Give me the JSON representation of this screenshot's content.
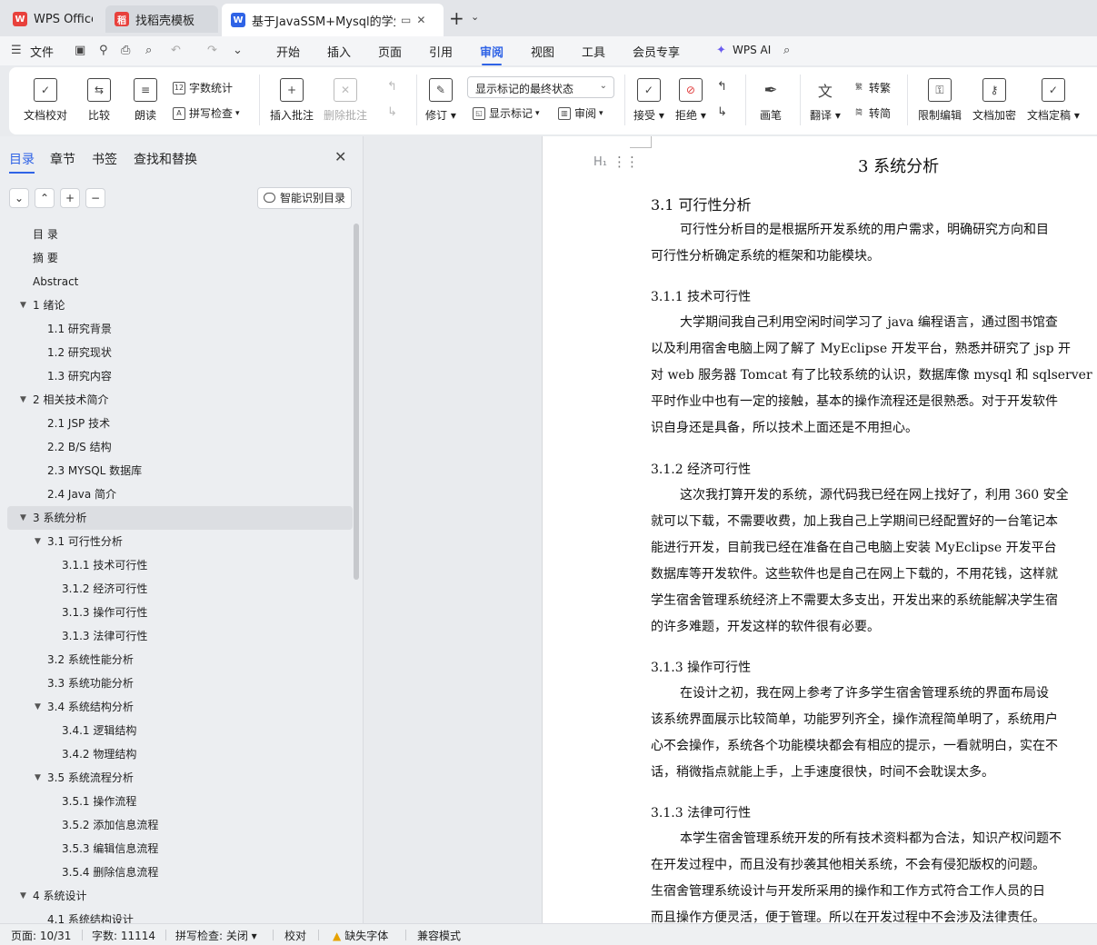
{
  "tabs": [
    {
      "label": "WPS Office",
      "logo": "W",
      "color": "#e8413c"
    },
    {
      "label": "找稻壳模板",
      "logo": "稻",
      "color": "#e8413c"
    },
    {
      "label": "基于JavaSSM+Mysql的学生宿",
      "logo": "W",
      "color": "#2f63e6"
    }
  ],
  "menubar": {
    "file": "文件",
    "items": [
      "开始",
      "插入",
      "页面",
      "引用",
      "审阅",
      "视图",
      "工具",
      "会员专享"
    ],
    "active": "审阅",
    "ai": "WPS AI"
  },
  "ribbon": {
    "doc_check": "文档校对",
    "compare": "比较",
    "read_aloud": "朗读",
    "word_count": "字数统计",
    "spell_check": "拼写检查",
    "insert_comment": "插入批注",
    "delete_comment": "删除批注",
    "revise": "修订",
    "markup_combo": "显示标记的最终状态",
    "show_markup": "显示标记",
    "review": "审阅",
    "accept": "接受",
    "reject": "拒绝",
    "pen": "画笔",
    "translate": "翻译",
    "to_traditional": "转繁",
    "to_simplified": "转简",
    "restrict_edit": "限制编辑",
    "encrypt": "文档加密",
    "finalize": "文档定稿"
  },
  "nav": {
    "tabs": [
      "目录",
      "章节",
      "书签",
      "查找和替换"
    ],
    "smart_btn": "智能识别目录",
    "toc": [
      {
        "text": "目  录",
        "level": 0,
        "caret": false
      },
      {
        "text": "摘    要",
        "level": 0,
        "caret": false
      },
      {
        "text": "Abstract",
        "level": 0,
        "caret": false
      },
      {
        "text": "1  绪论",
        "level": 0,
        "caret": true
      },
      {
        "text": "1.1 研究背景",
        "level": 1,
        "caret": false
      },
      {
        "text": "1.2 研究现状",
        "level": 1,
        "caret": false
      },
      {
        "text": "1.3 研究内容",
        "level": 1,
        "caret": false
      },
      {
        "text": "2  相关技术简介",
        "level": 0,
        "caret": true
      },
      {
        "text": "2.1 JSP 技术",
        "level": 1,
        "caret": false
      },
      {
        "text": "2.2 B/S 结构",
        "level": 1,
        "caret": false
      },
      {
        "text": "2.3 MYSQL 数据库",
        "level": 1,
        "caret": false
      },
      {
        "text": "2.4 Java 简介",
        "level": 1,
        "caret": false
      },
      {
        "text": "3  系统分析",
        "level": 0,
        "caret": true,
        "active": true
      },
      {
        "text": "3.1  可行性分析",
        "level": 1,
        "caret": true
      },
      {
        "text": "3.1.1  技术可行性",
        "level": 2,
        "caret": false
      },
      {
        "text": "3.1.2  经济可行性",
        "level": 2,
        "caret": false
      },
      {
        "text": "3.1.3  操作可行性",
        "level": 2,
        "caret": false
      },
      {
        "text": "3.1.3  法律可行性",
        "level": 2,
        "caret": false
      },
      {
        "text": "3.2  系统性能分析",
        "level": 1,
        "caret": false
      },
      {
        "text": "3.3  系统功能分析",
        "level": 1,
        "caret": false
      },
      {
        "text": "3.4  系统结构分析",
        "level": 1,
        "caret": true
      },
      {
        "text": "3.4.1 逻辑结构",
        "level": 2,
        "caret": false
      },
      {
        "text": "3.4.2  物理结构",
        "level": 2,
        "caret": false
      },
      {
        "text": "3.5  系统流程分析",
        "level": 1,
        "caret": true
      },
      {
        "text": "3.5.1  操作流程",
        "level": 2,
        "caret": false
      },
      {
        "text": "3.5.2  添加信息流程",
        "level": 2,
        "caret": false
      },
      {
        "text": "3.5.3  编辑信息流程",
        "level": 2,
        "caret": false
      },
      {
        "text": "3.5.4  删除信息流程",
        "level": 2,
        "caret": false
      },
      {
        "text": "4  系统设计",
        "level": 0,
        "caret": true
      },
      {
        "text": "4.1  系统结构设计",
        "level": 1,
        "caret": false
      }
    ]
  },
  "doc": {
    "h1": "3  系统分析",
    "h2": "3.1  可行性分析",
    "intro": [
      "可行性分析目的是根据所开发系统的用户需求，明确研究方向和目",
      "可行性分析确定系统的框架和功能模块。"
    ],
    "s1_title": "3.1.1  技术可行性",
    "s1": [
      "大学期间我自己利用空闲时间学习了 java 编程语言，通过图书馆查",
      "以及利用宿舍电脑上网了解了 MyEclipse 开发平台，熟悉并研究了 jsp 开",
      "对 web 服务器 Tomcat 有了比较系统的认识，数据库像 mysql 和 sqlserver",
      "平时作业中也有一定的接触，基本的操作流程还是很熟悉。对于开发软件",
      "识自身还是具备，所以技术上面还是不用担心。"
    ],
    "s2_title": "3.1.2  经济可行性",
    "s2": [
      "这次我打算开发的系统，源代码我已经在网上找好了，利用 360 安全",
      "就可以下载，不需要收费，加上我自己上学期间已经配置好的一台笔记本",
      "能进行开发，目前我已经在准备在自己电脑上安装 MyEclipse 开发平台",
      "数据库等开发软件。这些软件也是自己在网上下载的，不用花钱，这样就",
      "学生宿舍管理系统经济上不需要太多支出，开发出来的系统能解决学生宿",
      "的许多难题，开发这样的软件很有必要。"
    ],
    "s3_title": "3.1.3  操作可行性",
    "s3": [
      "在设计之初，我在网上参考了许多学生宿舍管理系统的界面布局设",
      "该系统界面展示比较简单，功能罗列齐全，操作流程简单明了，系统用户",
      "心不会操作，系统各个功能模块都会有相应的提示，一看就明白，实在不",
      "话，稍微指点就能上手，上手速度很快，时间不会耽误太多。"
    ],
    "s4_title": "3.1.3  法律可行性",
    "s4": [
      "本学生宿舍管理系统开发的所有技术资料都为合法，知识产权问题不",
      "在开发过程中，而且没有抄袭其他相关系统，不会有侵犯版权的问题。",
      "生宿舍管理系统设计与开发所采用的操作和工作方式符合工作人员的日",
      "而且操作方便灵活，便于管理。所以在开发过程中不会涉及法律责任。"
    ]
  },
  "status": {
    "page": "页面: 10/31",
    "words": "字数: 11114",
    "spell": "拼写检查: 关闭",
    "proof": "校对",
    "missing_font": "缺失字体",
    "compat": "兼容模式"
  }
}
